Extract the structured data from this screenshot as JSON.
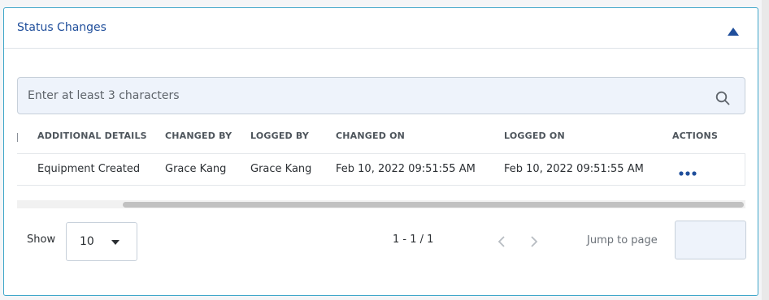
{
  "panel": {
    "title": "Status Changes",
    "collapse_icon": "triangle-up-icon"
  },
  "search": {
    "placeholder": "Enter at least 3 characters",
    "value": "",
    "icon": "search-icon"
  },
  "table": {
    "columns": [
      "ADDITIONAL DETAILS",
      "CHANGED BY",
      "LOGGED BY",
      "CHANGED ON",
      "LOGGED ON",
      "ACTIONS"
    ],
    "rows": [
      {
        "additional_details": "Equipment Created",
        "changed_by": "Grace Kang",
        "logged_by": "Grace Kang",
        "changed_on": "Feb 10, 2022 09:51:55 AM",
        "logged_on": "Feb 10, 2022 09:51:55 AM",
        "actions_icon": "more-horizontal-icon"
      }
    ]
  },
  "pagination": {
    "show_label": "Show",
    "page_size": "10",
    "range_text": "1 - 1 / 1",
    "jump_label": "Jump to page",
    "jump_value": ""
  },
  "colors": {
    "accent": "#1f4e9b",
    "panel_border": "#3fa6c9",
    "input_bg": "#eef3fb"
  }
}
